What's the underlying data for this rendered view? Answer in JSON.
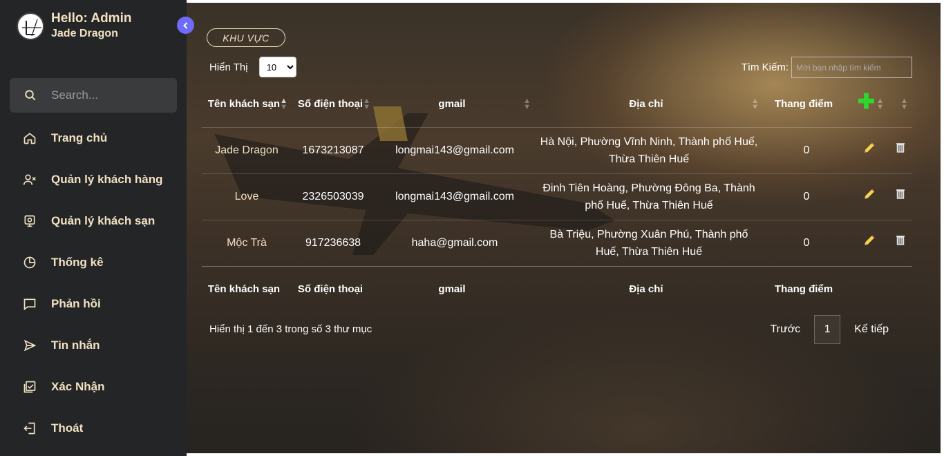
{
  "sidebar": {
    "greeting": "Hello: Admin",
    "hotel": "Jade Dragon",
    "search_placeholder": "Search...",
    "items": [
      {
        "label": "Trang chủ",
        "icon": "home-icon"
      },
      {
        "label": "Quản lý khách hàng",
        "icon": "user-x-icon"
      },
      {
        "label": "Quản lý khách sạn",
        "icon": "hotel-monitor-icon"
      },
      {
        "label": "Thống kê",
        "icon": "pie-chart-icon"
      },
      {
        "label": "Phản hồi",
        "icon": "message-square-icon"
      },
      {
        "label": "Tin nhắn",
        "icon": "send-icon"
      },
      {
        "label": "Xác Nhận",
        "icon": "check-square-icon"
      },
      {
        "label": "Thoát",
        "icon": "logout-icon"
      }
    ]
  },
  "main": {
    "region_badge": "KHU VỰC",
    "show_label": "Hiển Thị",
    "show_value": "10",
    "search_label": "Tìm Kiếm:",
    "search_placeholder": "Mời bạn nhập tìm kiếm",
    "columns": [
      "Tên khách sạn",
      "Số điện thoại",
      "gmail",
      "Địa chỉ",
      "Thang điểm"
    ],
    "rows": [
      {
        "name": "Jade Dragon",
        "phone": "1673213087",
        "gmail": "longmai143@gmail.com",
        "address": "Hà Nội, Phường Vĩnh Ninh, Thành phố Huế, Thừa Thiên Huế",
        "score": "0"
      },
      {
        "name": "Love",
        "phone": "2326503039",
        "gmail": "longmai143@gmail.com",
        "address": "Đinh Tiên Hoàng, Phường Đông Ba, Thành phố Huế, Thừa Thiên Huế",
        "score": "0"
      },
      {
        "name": "Mộc Trà",
        "phone": "917236638",
        "gmail": "haha@gmail.com",
        "address": "Bà Triệu, Phường Xuân Phú, Thành phố Huế, Thừa Thiên Huế",
        "score": "0"
      }
    ],
    "info": "Hiển thị 1 đến 3 trong số 3 thư mục",
    "pager": {
      "prev": "Trước",
      "page": "1",
      "next": "Kế tiếp"
    }
  },
  "colors": {
    "sidebar_bg": "#242526",
    "accent_text": "#f1e1c3",
    "toggle": "#6f6af8",
    "add_green": "#2fd62f"
  }
}
